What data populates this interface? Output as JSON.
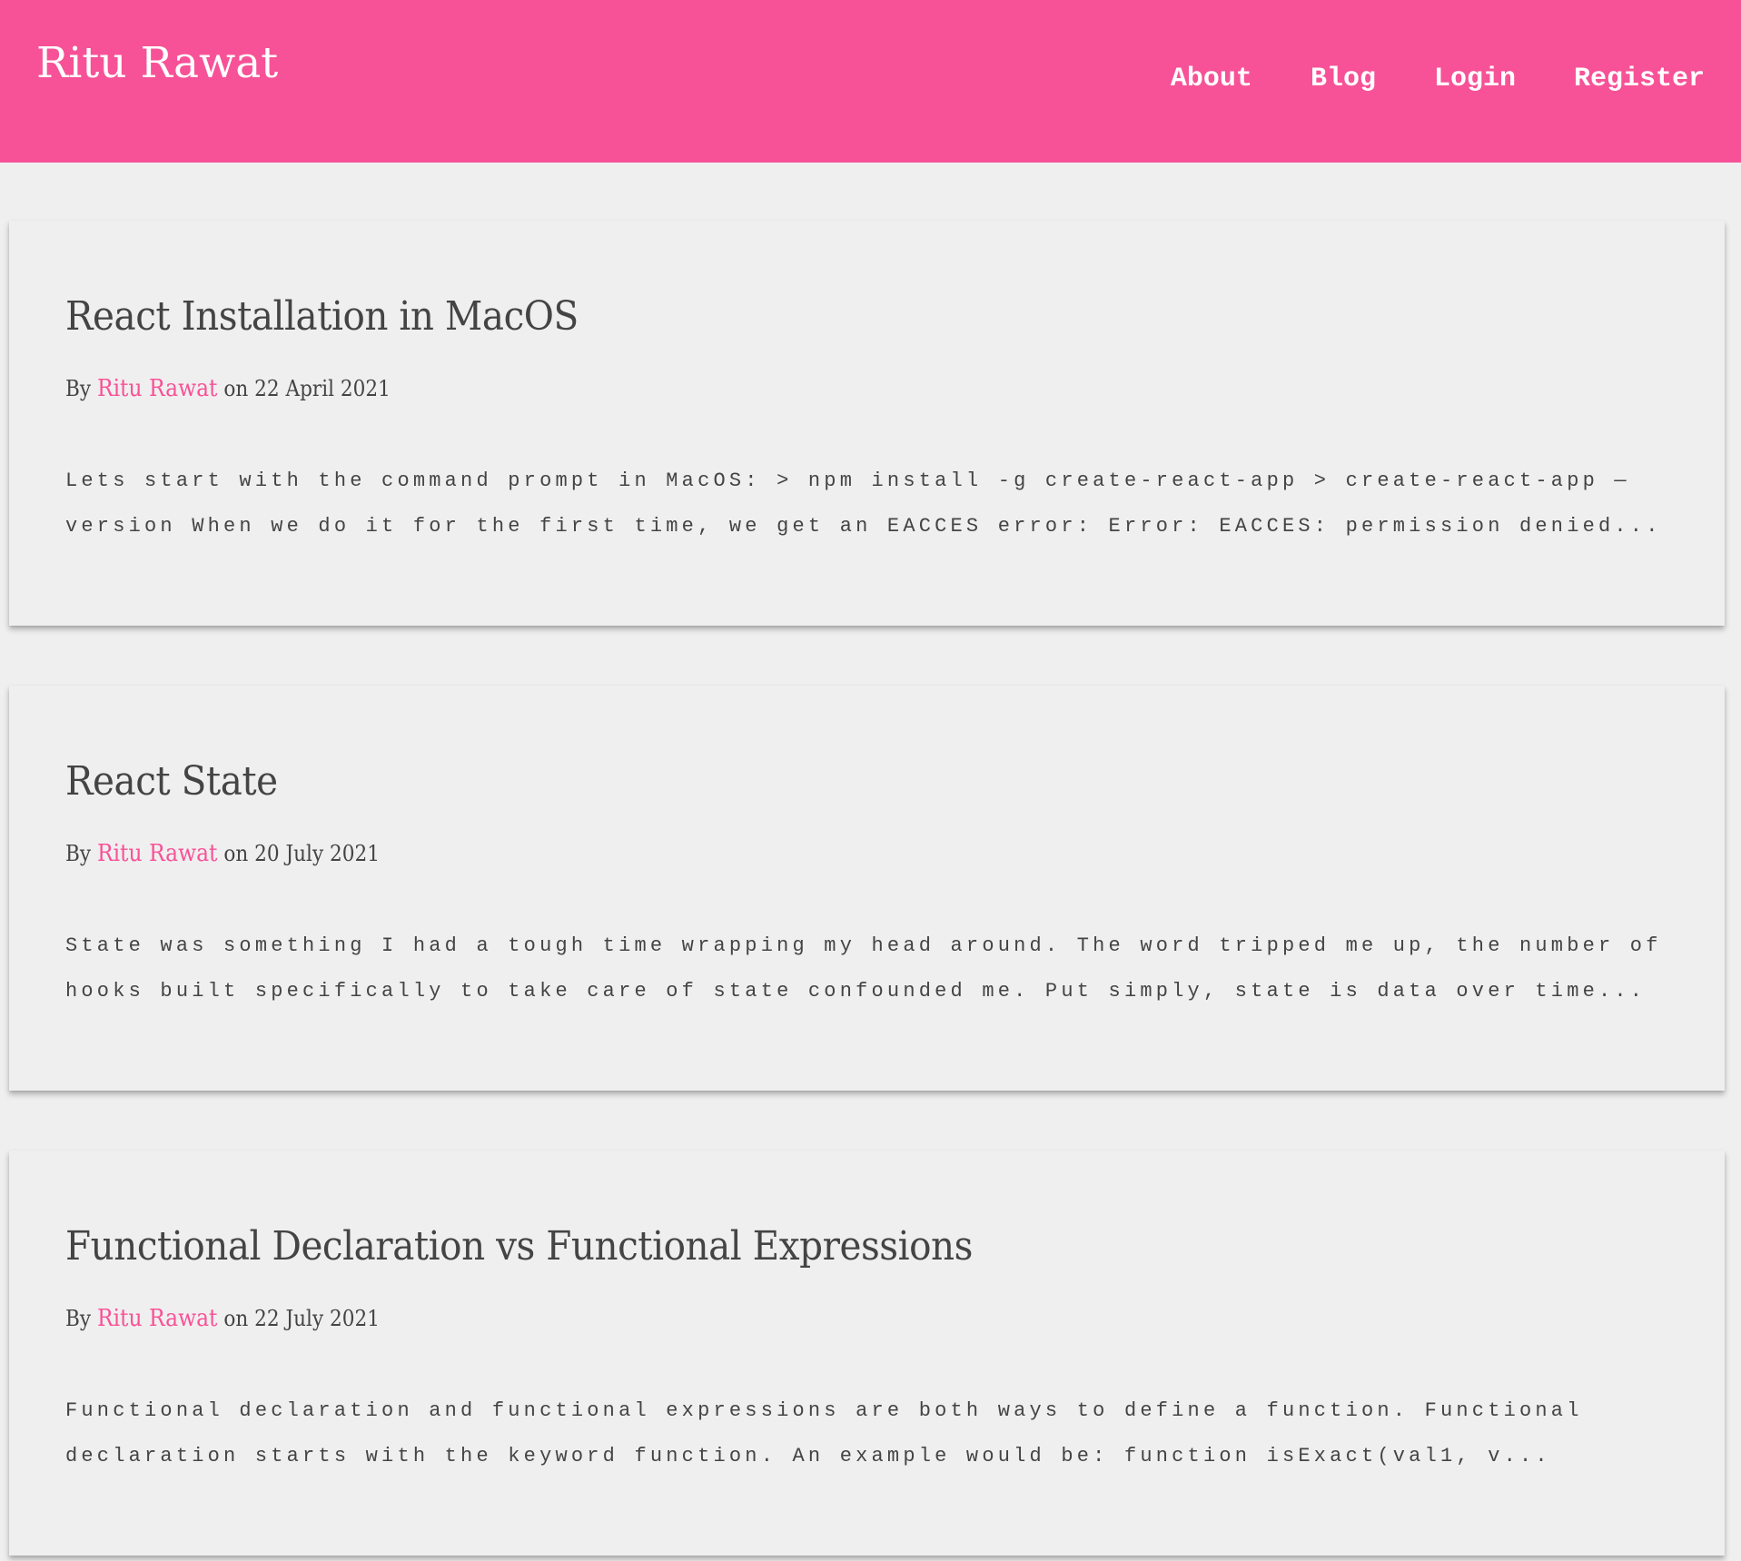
{
  "header": {
    "brand": "Ritu Rawat",
    "nav": [
      {
        "label": "About"
      },
      {
        "label": "Blog"
      },
      {
        "label": "Login"
      },
      {
        "label": "Register"
      }
    ],
    "brand_color": "#f75297"
  },
  "posts": [
    {
      "title": "React Installation in MacOS",
      "by_label": "By",
      "author": "Ritu Rawat",
      "on_label": "on",
      "date": "22 April 2021",
      "excerpt": "Lets start with the command prompt in MacOS: > npm install -g create-react-app > create-react-app —version When we do it for the first time, we get an EACCES error: Error: EACCES: permission denied..."
    },
    {
      "title": "React State",
      "by_label": "By",
      "author": "Ritu Rawat",
      "on_label": "on",
      "date": "20 July 2021",
      "excerpt": "State was something I had a tough time wrapping my head around. The word tripped me up, the number of hooks built specifically to take care of state confounded me. Put simply, state is data over time..."
    },
    {
      "title": "Functional Declaration vs Functional Expressions",
      "by_label": "By",
      "author": "Ritu Rawat",
      "on_label": "on",
      "date": "22 July 2021",
      "excerpt": "Functional declaration and functional expressions are both ways to define a function. Functional declaration starts with the keyword function. An example would be: function isExact(val1, v..."
    }
  ]
}
